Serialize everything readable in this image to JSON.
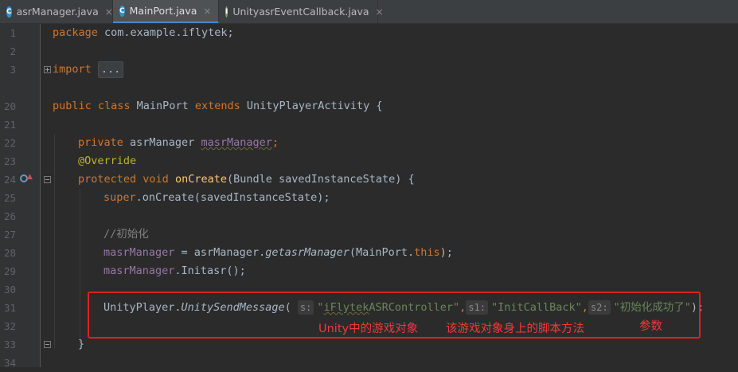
{
  "tabs": [
    {
      "icon": "class-icon",
      "icon_letter": "C",
      "label": "asrManager.java",
      "active": false
    },
    {
      "icon": "class-icon",
      "icon_letter": "C",
      "label": "MainPort.java",
      "active": true
    },
    {
      "icon": "interface-icon",
      "icon_letter": "I",
      "label": "UnityasrEventCallback.java",
      "active": false
    }
  ],
  "close_glyph": "×",
  "lines": {
    "l1": {
      "num": "1",
      "t1": "package",
      "t2": " com.example.iflytek;"
    },
    "l2": {
      "num": "2"
    },
    "l3": {
      "num": "3",
      "t1": "import",
      "t2": " ",
      "fold": "..."
    },
    "l20": {
      "num": "20",
      "t1": "public class",
      "t2": " MainPort ",
      "t3": "extends",
      "t4": " UnityPlayerActivity {"
    },
    "l21": {
      "num": "21"
    },
    "l22": {
      "num": "22",
      "t1": "private",
      "t2": " asrManager ",
      "t3": "masrManager",
      "t4": ";"
    },
    "l23": {
      "num": "23",
      "t1": "@Override"
    },
    "l24": {
      "num": "24",
      "t1": "protected void",
      "t2": " ",
      "t3": "onCreate",
      "t4": "(Bundle savedInstanceState) {"
    },
    "l25": {
      "num": "25",
      "t1": "super",
      "t2": ".onCreate(savedInstanceState);"
    },
    "l26": {
      "num": "26"
    },
    "l27": {
      "num": "27",
      "t1": "//初始化"
    },
    "l28": {
      "num": "28",
      "t1": "masrManager",
      "t2": " = asrManager.",
      "t3": "getasrManager",
      "t4": "(MainPort.",
      "t5": "this",
      "t6": ");"
    },
    "l29": {
      "num": "29",
      "t1": "masrManager",
      "t2": ".Initasr();"
    },
    "l30": {
      "num": "30"
    },
    "l31": {
      "num": "31",
      "t1": "UnityPlayer.",
      "t2": "UnitySendMessage",
      "t3": "(",
      "h1": "s:",
      "s1q": "\"",
      "s1a": "iFlytek",
      "s1b": "ASRController\"",
      "c1": ",",
      "h2": "s1:",
      "s2": "\"InitCallBack\"",
      "c2": ",",
      "h3": "s2:",
      "s3": "\"初始化成功了\"",
      "t4": ");"
    },
    "l32": {
      "num": "32"
    },
    "l33": {
      "num": "33",
      "t1": "}"
    },
    "l34": {
      "num": "34"
    }
  },
  "annotations": {
    "game_object": "Unity中的游戏对象",
    "script_method": "该游戏对象身上的脚本方法",
    "param": "参数"
  },
  "colors": {
    "editor_bg": "#2b2b2b",
    "keyword": "#cc7832",
    "string": "#6a8759",
    "annotation_box": "#e02020"
  }
}
